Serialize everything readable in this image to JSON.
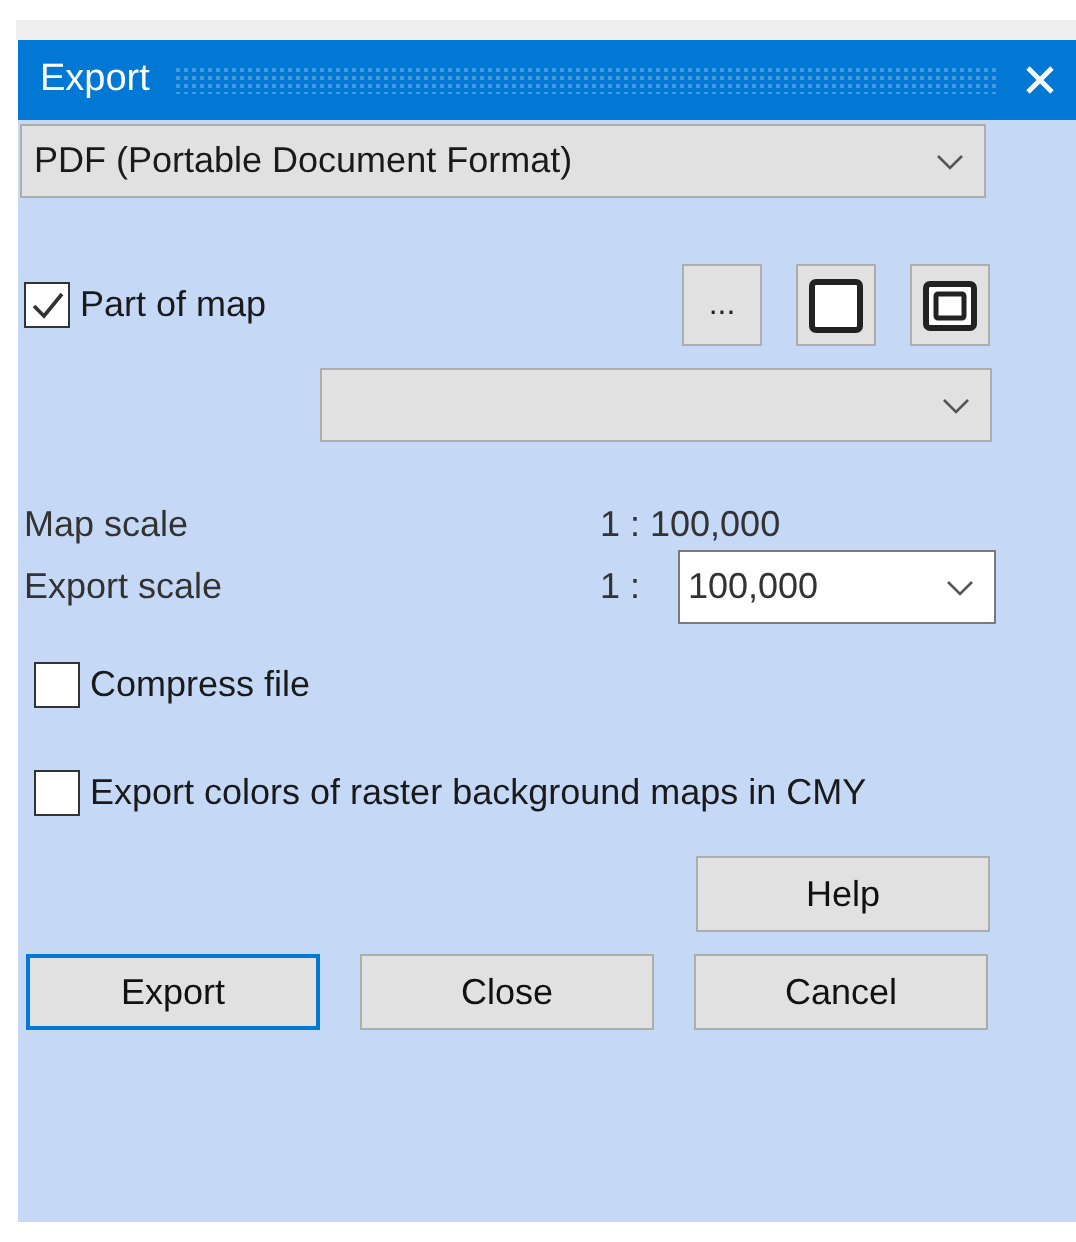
{
  "window": {
    "title": "Export"
  },
  "format_dropdown": {
    "value": "PDF (Portable Document Format)"
  },
  "part_of_map": {
    "label": "Part of map",
    "checked": true
  },
  "tool_buttons": [
    {
      "kind": "ellipsis",
      "label": "..."
    },
    {
      "kind": "frame"
    },
    {
      "kind": "double-frame"
    }
  ],
  "map_scale": {
    "label": "Map scale",
    "value": "1 : 100,000"
  },
  "export_scale": {
    "label": "Export scale",
    "prefix": "1 :",
    "value": "100,000"
  },
  "options": [
    {
      "label": "Compress file",
      "checked": false
    },
    {
      "label": "Export colors of raster background maps in CMY",
      "checked": false
    }
  ],
  "help_button": {
    "label": "Help"
  },
  "buttons": [
    {
      "label": "Export",
      "focused": true
    },
    {
      "label": "Close",
      "focused": false
    },
    {
      "label": "Cancel",
      "focused": false
    }
  ]
}
